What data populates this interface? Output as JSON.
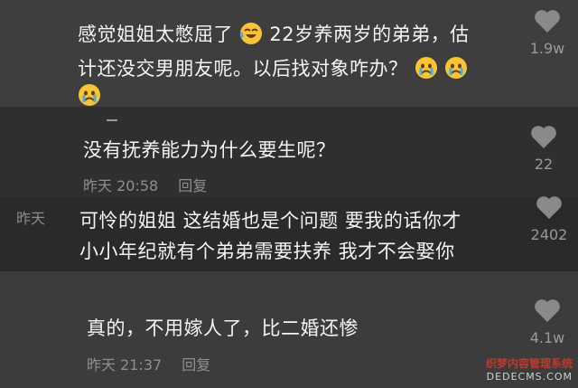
{
  "comments": [
    {
      "line1": "感觉姐姐太憋屈了",
      "line1b": "22岁养两岁的弟弟，估",
      "line2": "计还没交男朋友呢。以后找对象咋办？",
      "likes": "1.9w"
    },
    {
      "text": "没有抚养能力为什么要生呢？",
      "time": "昨天 20:58",
      "reply": "回复",
      "likes": "22"
    },
    {
      "line1": "可怜的姐姐 这结婚也是个问题 要我的话你才",
      "line2": "小小年纪就有个弟弟需要扶养 我才不会娶你",
      "likes": "2402",
      "ghost_time": "昨天"
    },
    {
      "text": "真的，不用嫁人了，比二婚还惨",
      "time": "昨天 21:37",
      "reply": "回复",
      "likes": "4.1w"
    }
  ],
  "watermark": {
    "line1": "织梦内容管理系统",
    "line2": "DEDECMS.COM"
  },
  "icons": {
    "like": "heart-icon",
    "emoji_laugh": "laughing-crying-emoji",
    "emoji_cry": "crying-emoji"
  }
}
